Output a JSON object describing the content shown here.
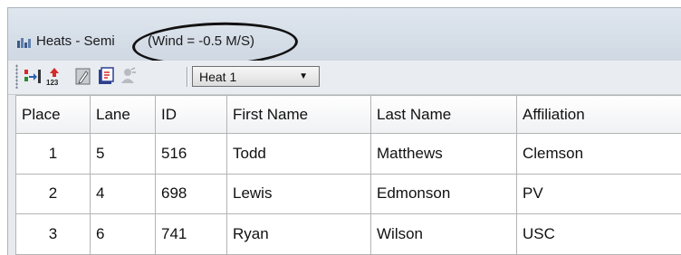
{
  "window": {
    "title_main": "Heats - Semi",
    "title_annotation": "(Wind = -0.5 M/S)"
  },
  "toolbar": {
    "buttons": [
      {
        "icon": "assign-lanes-icon"
      },
      {
        "icon": "sort-123-icon"
      },
      {
        "icon": "edit-icon"
      },
      {
        "icon": "print-icon"
      },
      {
        "icon": "announce-icon"
      }
    ],
    "heat_select": {
      "value": "Heat 1"
    }
  },
  "table": {
    "columns": [
      "Place",
      "Lane",
      "ID",
      "First Name",
      "Last Name",
      "Affiliation"
    ],
    "rows": [
      {
        "place": "1",
        "lane": "5",
        "id": "516",
        "first": "Todd",
        "last": "Matthews",
        "affiliation": "Clemson"
      },
      {
        "place": "2",
        "lane": "4",
        "id": "698",
        "first": "Lewis",
        "last": "Edmonson",
        "affiliation": "PV"
      },
      {
        "place": "3",
        "lane": "6",
        "id": "741",
        "first": "Ryan",
        "last": "Wilson",
        "affiliation": "USC"
      }
    ]
  }
}
